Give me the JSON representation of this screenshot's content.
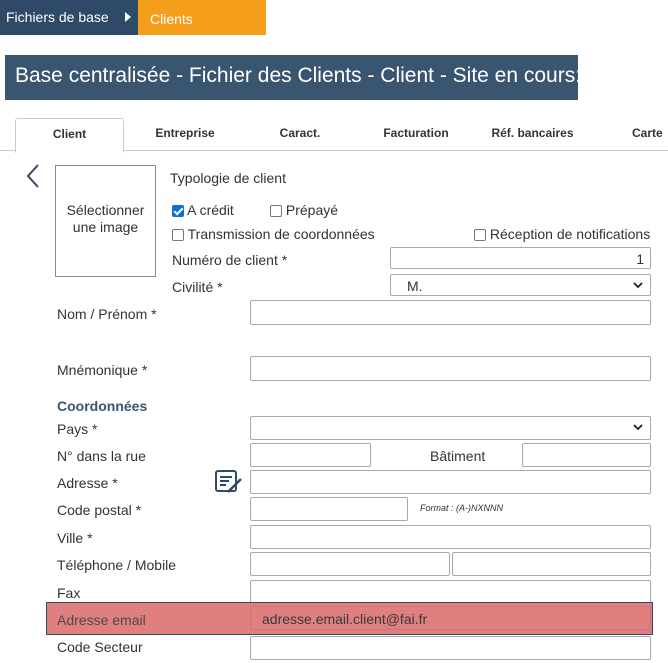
{
  "breadcrumb": {
    "first": "Fichiers de base",
    "current": "Clients"
  },
  "banner": {
    "title": "Base centralisée - Fichier des Clients - Client - Site en cours:"
  },
  "tabs": [
    {
      "label": "Client"
    },
    {
      "label": "Entreprise"
    },
    {
      "label": "Caract."
    },
    {
      "label": "Facturation"
    },
    {
      "label": "Réf. bancaires"
    },
    {
      "label": "Carte"
    }
  ],
  "image_box": {
    "label_line1": "Sélectionner",
    "label_line2": "une image"
  },
  "typologie": {
    "label": "Typologie de client",
    "a_credit": "A crédit",
    "prepaye": "Prépayé",
    "transmission": "Transmission de coordonnées",
    "reception": "Réception de notifications"
  },
  "numero": {
    "label": "Numéro de client *",
    "value": "1"
  },
  "civilite": {
    "label": "Civilité *",
    "value": "M."
  },
  "nom": {
    "label": "Nom / Prénom *"
  },
  "mnemonique": {
    "label": "Mnémonique *"
  },
  "coordonnees": {
    "section": "Coordonnées"
  },
  "pays": {
    "label": "Pays *"
  },
  "num_rue": {
    "label": "N° dans la rue"
  },
  "batiment": {
    "label": "Bâtiment"
  },
  "adresse": {
    "label": "Adresse *"
  },
  "code_postal": {
    "label": "Code postal *",
    "hint": "Format : (A-)NXNNN"
  },
  "ville": {
    "label": "Ville *"
  },
  "telephone": {
    "label": "Téléphone / Mobile"
  },
  "fax": {
    "label": "Fax"
  },
  "email": {
    "label": "Adresse email",
    "value": "adresse.email.client@fai.fr"
  },
  "code_secteur": {
    "label": "Code Secteur"
  },
  "colors": {
    "primary_dark": "#2f4a66",
    "accent": "#f59e1c",
    "banner": "#3a5570",
    "highlight": "#e07f7f",
    "checkbox": "#0b6fd6"
  },
  "icons": {
    "back": "chevron-left-icon",
    "address": "address-list-icon",
    "dropdown": "chevron-down-icon"
  }
}
